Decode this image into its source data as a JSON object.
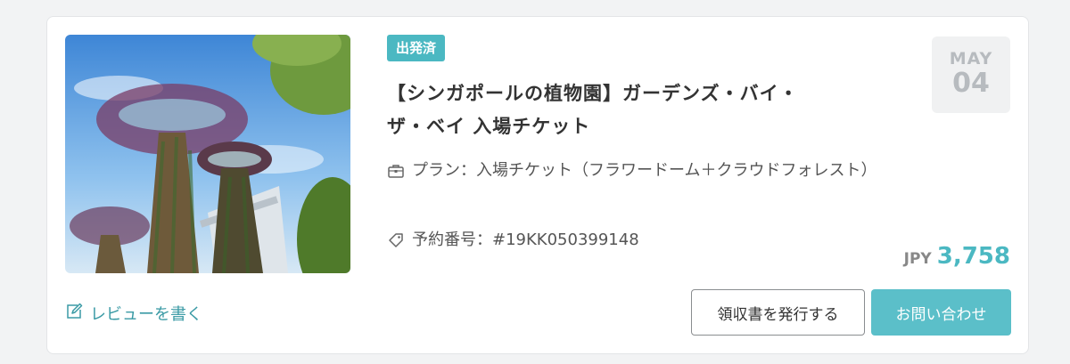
{
  "booking": {
    "status_badge": "出発済",
    "title_line1": "【シンガポールの植物園】ガーデンズ・バイ・",
    "title_line2": "ザ・ベイ 入場チケット",
    "plan_text": "プラン：入場チケット（フラワードーム＋クラウドフォレスト）",
    "reservation_text": "予約番号：#19KK050399148",
    "date_month": "MAY",
    "date_day": "04",
    "price_currency": "JPY",
    "price_amount": "3,758",
    "icons": {
      "plan": "briefcase-icon",
      "reservation": "tag-icon",
      "review": "edit-icon"
    }
  },
  "actions": {
    "review_label": "レビューを書く",
    "receipt_label": "領収書を発行する",
    "contact_label": "お問い合わせ"
  },
  "colors": {
    "accent": "#4bb8c2",
    "button_accent": "#5bbfc9",
    "link": "#3a9aa5"
  }
}
